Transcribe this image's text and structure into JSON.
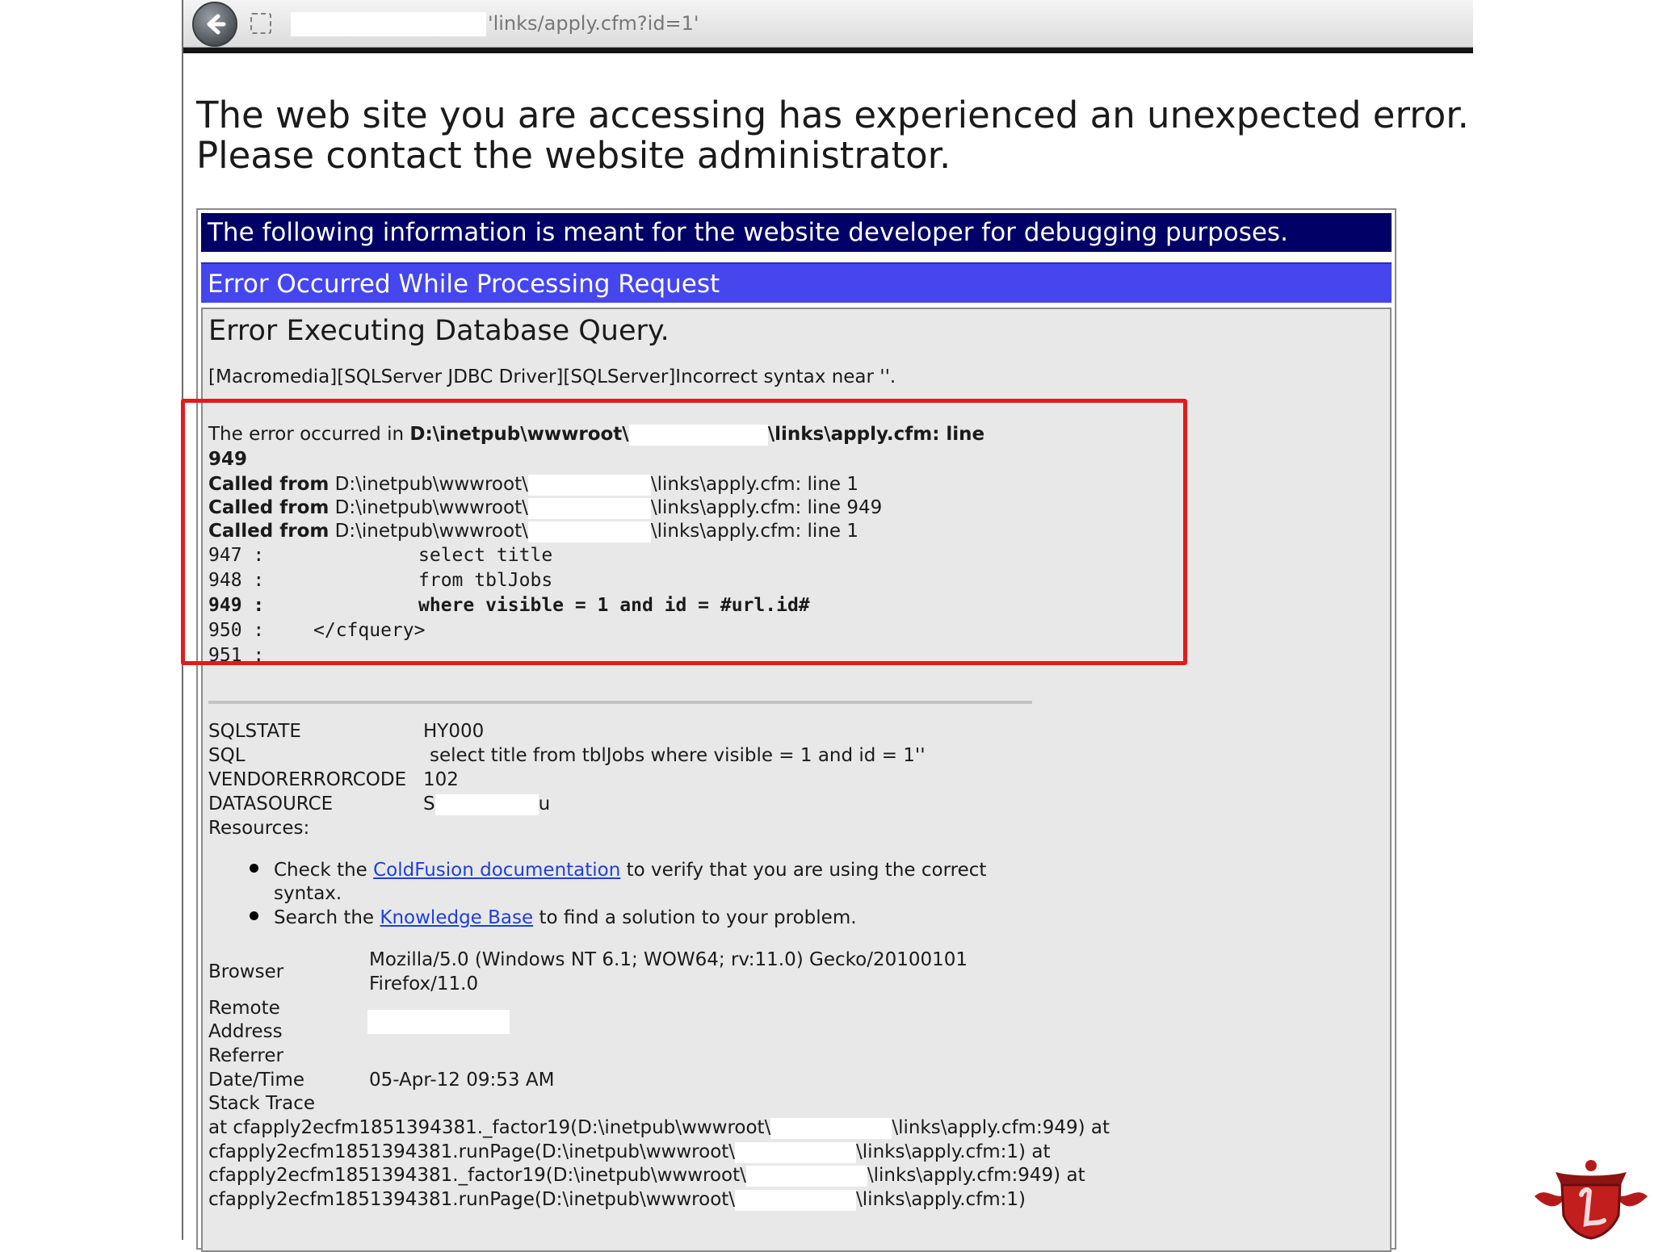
{
  "browser": {
    "url": "'links/apply.cfm?id=1'"
  },
  "page": {
    "headline_line1": "The web site you are accessing has experienced an unexpected error.",
    "headline_line2": "Please contact the website administrator.",
    "debug_header": "The following information is meant for the website developer for debugging purposes.",
    "error_bar": "Error Occurred While Processing Request",
    "error_title": "Error Executing Database Query.",
    "driver_message": "[Macromedia][SQLServer JDBC Driver][SQLServer]Incorrect syntax near ''.",
    "location": {
      "prefix": "The error occurred in ",
      "path_start": "D:\\inetpub\\wwwroot\\",
      "path_end": "\\links\\apply.cfm: line",
      "line": "949"
    },
    "called_from": [
      {
        "label": "Called from",
        "path_start": "D:\\inetpub\\wwwroot\\",
        "path_end": "\\links\\apply.cfm: line 1"
      },
      {
        "label": "Called from",
        "path_start": "D:\\inetpub\\wwwroot\\",
        "path_end": "\\links\\apply.cfm: line 949"
      },
      {
        "label": "Called from",
        "path_start": "D:\\inetpub\\wwwroot\\",
        "path_end": "\\links\\apply.cfm: line 1"
      }
    ],
    "code_lines": [
      {
        "num": "947 :",
        "code": "select title"
      },
      {
        "num": "948 :",
        "code": "from tblJobs"
      },
      {
        "num": "949 :",
        "code": "where visible = 1 and id = #url.id#"
      },
      {
        "num": "950 :",
        "code": "</cfquery>"
      },
      {
        "num": "951 :",
        "code": ""
      }
    ],
    "sql_info": [
      {
        "key": "SQLSTATE",
        "value": "HY000"
      },
      {
        "key": "SQL",
        "value": "select title from tblJobs where visible = 1 and id = 1''"
      },
      {
        "key": "VENDORERRORCODE",
        "value": "102"
      },
      {
        "key": "DATASOURCE",
        "value_start": "S",
        "value_end": "u"
      }
    ],
    "resources_label": "Resources:",
    "resources": [
      {
        "before": "Check the ",
        "link": "ColdFusion documentation",
        "after": " to verify that you are using the correct",
        "after2": "syntax."
      },
      {
        "before": "Search the ",
        "link": "Knowledge Base",
        "after": " to find a solution to your problem."
      }
    ],
    "browser_info": {
      "browser_label": "Browser",
      "browser_value_line1": "Mozilla/5.0 (Windows NT 6.1; WOW64; rv:11.0) Gecko/20100101",
      "browser_value_line2": "Firefox/11.0",
      "remote_label_line1": "Remote",
      "remote_label_line2": "Address",
      "referrer_label": "Referrer",
      "datetime_label": "Date/Time",
      "datetime_value": "05-Apr-12 09:53 AM",
      "stack_label": "Stack Trace"
    },
    "stack_trace": [
      {
        "start": "at cfapply2ecfm1851394381._factor19(D:\\inetpub\\wwwroot\\",
        "end": "\\links\\apply.cfm:949) at"
      },
      {
        "start": "cfapply2ecfm1851394381.runPage(D:\\inetpub\\wwwroot\\",
        "end": "\\links\\apply.cfm:1) at"
      },
      {
        "start": "cfapply2ecfm1851394381._factor19(D:\\inetpub\\wwwroot\\",
        "end": "\\links\\apply.cfm:949) at"
      },
      {
        "start": "cfapply2ecfm1851394381.runPage(D:\\inetpub\\wwwroot\\",
        "end": "\\links\\apply.cfm:1)"
      }
    ]
  },
  "colors": {
    "header_navy": "#000066",
    "error_bar_blue": "#4646ee",
    "highlight_red": "#e41a1a",
    "link_blue": "#1f3fd8"
  }
}
